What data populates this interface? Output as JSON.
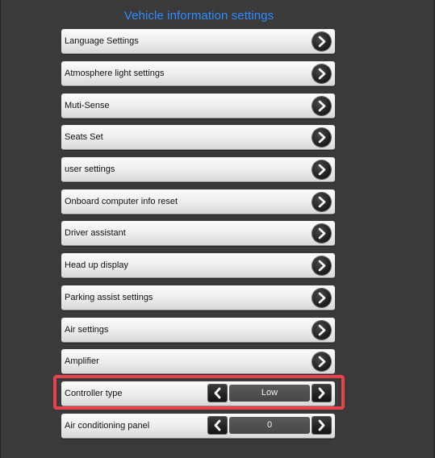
{
  "title": "Vehicle information settings",
  "menu_items": [
    {
      "label": "Language Settings",
      "icon": "chevron-right-icon"
    },
    {
      "label": "Atmosphere light settings",
      "icon": "chevron-right-icon"
    },
    {
      "label": "Muti-Sense",
      "icon": "chevron-right-icon"
    },
    {
      "label": "Seats Set",
      "icon": "chevron-right-icon"
    },
    {
      "label": "user settings",
      "icon": "chevron-right-icon"
    },
    {
      "label": "Onboard computer info reset",
      "icon": "chevron-right-icon"
    },
    {
      "label": "Driver assistant",
      "icon": "chevron-right-icon"
    },
    {
      "label": "Head up display",
      "icon": "chevron-right-icon"
    },
    {
      "label": "Parking assist settings",
      "icon": "chevron-right-icon"
    },
    {
      "label": "Air settings",
      "icon": "chevron-right-icon"
    },
    {
      "label": "Amplifier",
      "icon": "chevron-right-icon"
    }
  ],
  "steppers": [
    {
      "label": "Controller type",
      "value": "Low",
      "highlighted": true
    },
    {
      "label": "Air conditioning panel",
      "value": "0",
      "highlighted": false
    }
  ],
  "colors": {
    "title": "#2f8cff",
    "background": "#3a3a3a",
    "highlight": "#e8424f"
  }
}
